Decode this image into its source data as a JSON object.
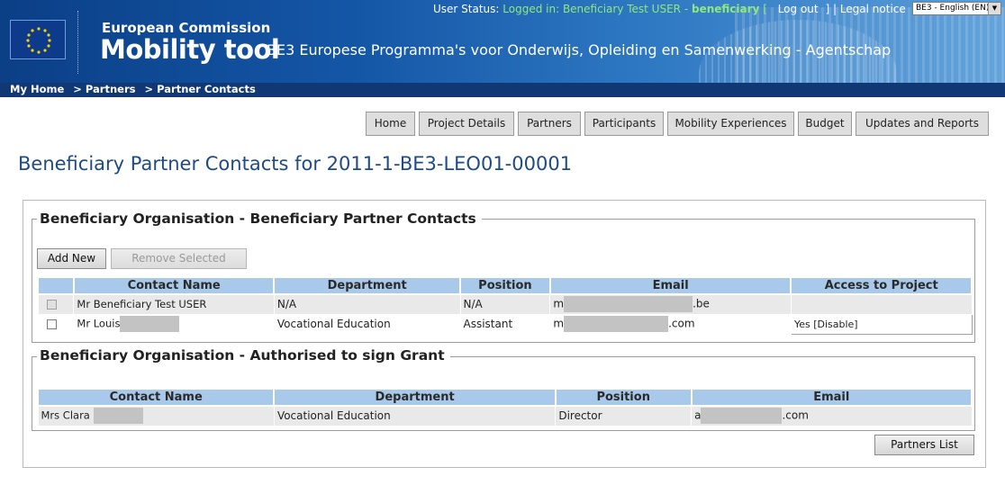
{
  "header": {
    "org": "European Commission",
    "app_name": "Mobility tool",
    "agency": "BE3 Europese Programma's voor Onderwijs, Opleiding en Samenwerking - Agentschap",
    "status_label": "User Status:",
    "status_logged": "Logged in: Beneficiary Test USER -",
    "status_user": "beneficiary",
    "bracket_open": "[",
    "logout": "Log out",
    "bracket_close": "]",
    "pipe": "|",
    "legal": "Legal notice",
    "language": "BE3 - English (EN)"
  },
  "breadcrumb": [
    "My Home",
    "> Partners",
    "> Partner Contacts"
  ],
  "nav": [
    "Home",
    "Project Details",
    "Partners",
    "Participants",
    "Mobility Experiences",
    "Budget",
    "Updates and Reports"
  ],
  "page_title": "Beneficiary Partner Contacts for 2011-1-BE3-LEO01-00001",
  "contacts_section": {
    "legend": "Beneficiary Organisation - Beneficiary Partner Contacts",
    "add_new": "Add New",
    "remove_selected": "Remove Selected",
    "headers": [
      "Contact Name",
      "Department",
      "Position",
      "Email",
      "Access to Project"
    ],
    "rows": [
      {
        "name": "Mr Beneficiary Test USER",
        "department": "N/A",
        "position": "N/A",
        "email_prefix": "m",
        "email_suffix": ".be",
        "access": ""
      },
      {
        "name": "Mr Louis",
        "department": "Vocational Education",
        "position": "Assistant",
        "email_prefix": "m",
        "email_suffix": ".com",
        "access": "Yes [Disable]"
      }
    ]
  },
  "sign_section": {
    "legend": "Beneficiary Organisation - Authorised to sign Grant",
    "headers": [
      "Contact Name",
      "Department",
      "Position",
      "Email"
    ],
    "rows": [
      {
        "name": "Mrs Clara",
        "department": "Vocational Education",
        "position": "Director",
        "email_prefix": "a",
        "email_suffix": ".com"
      }
    ]
  },
  "partners_list": "Partners List"
}
